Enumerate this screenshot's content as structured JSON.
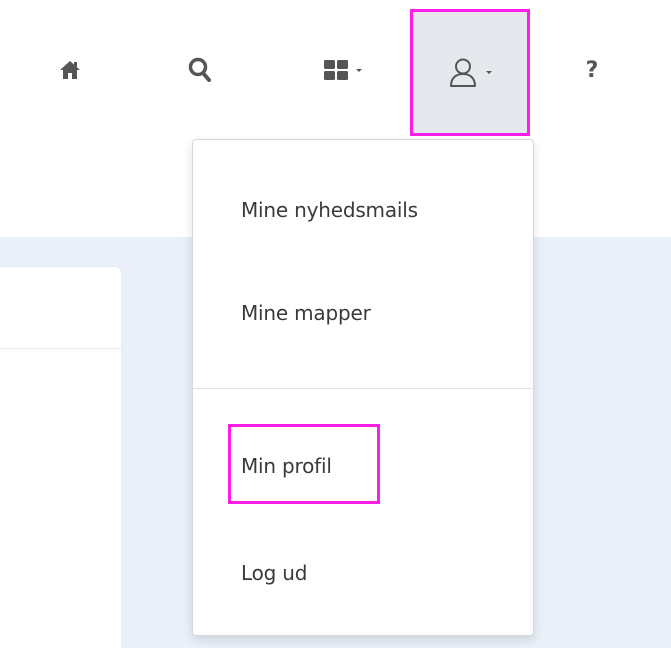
{
  "header": {
    "icons": {
      "home": "home-icon",
      "search": "search-icon",
      "apps": "grid-icon",
      "user": "user-icon",
      "help": "help-icon"
    },
    "help_label": "?"
  },
  "user_menu": {
    "items": [
      {
        "label": "Mine nyhedsmails"
      },
      {
        "label": "Mine mapper"
      },
      {
        "label": "Min profil"
      },
      {
        "label": "Log ud"
      }
    ]
  },
  "colors": {
    "highlight": "#ff1ee8",
    "content_background": "#e9f0f8",
    "icon": "#555555",
    "text": "#3a3a3a"
  }
}
